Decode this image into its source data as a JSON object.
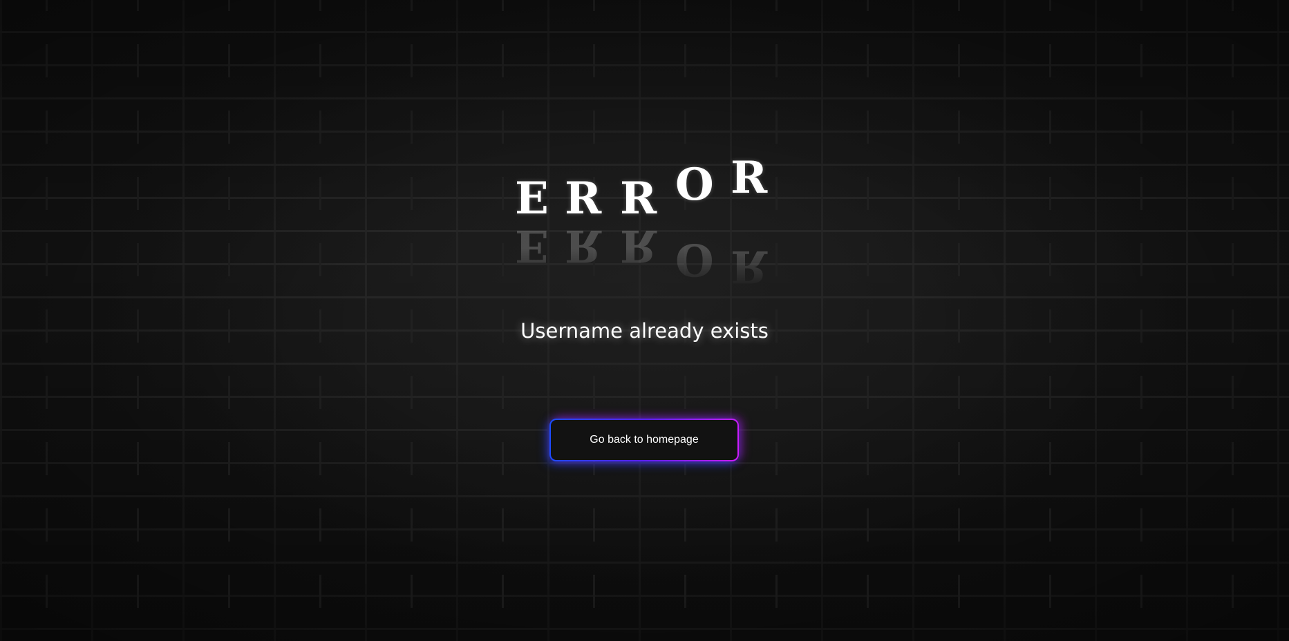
{
  "error": {
    "letters": [
      "E",
      "R",
      "R",
      "O",
      "R"
    ]
  },
  "message": "Username already exists",
  "button": {
    "label": "Go back to homepage"
  },
  "colors": {
    "text": "#ffffff",
    "background": "#151515",
    "button_gradient_start": "#1a4dff",
    "button_gradient_end": "#d01cff"
  }
}
